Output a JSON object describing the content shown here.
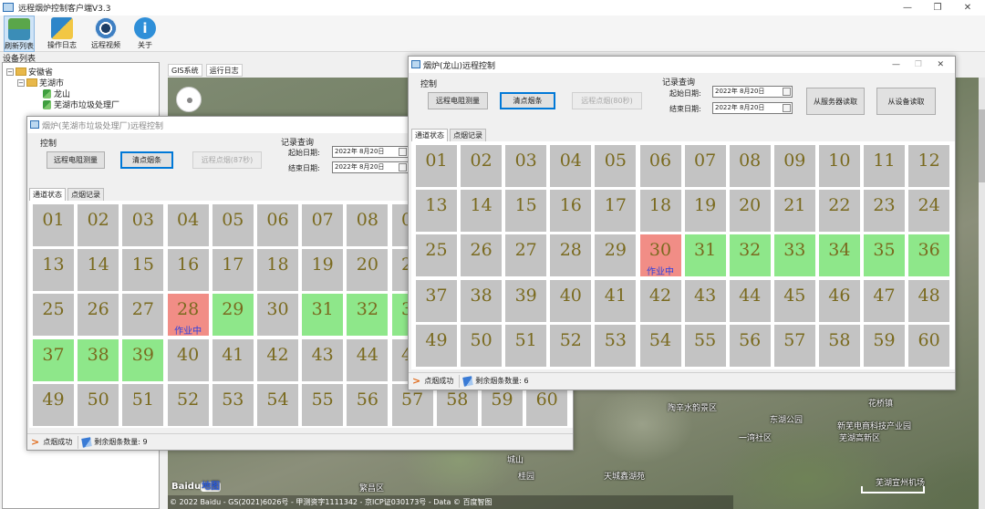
{
  "app": {
    "title": "远程烟炉控制客户端V3.3"
  },
  "window_controls": {
    "minimize": "—",
    "restore": "❐",
    "close": "✕"
  },
  "toolbar": [
    {
      "label": "刷新列表",
      "icon": "refresh-icon"
    },
    {
      "label": "操作日志",
      "icon": "log-icon"
    },
    {
      "label": "远程视频",
      "icon": "camera-icon"
    },
    {
      "label": "关于",
      "icon": "info-icon"
    }
  ],
  "colors": {
    "cell_gray": "#c3c3c3",
    "cell_green": "#8ee78a",
    "cell_red": "#f18d86",
    "cell_text": "#7a6a1f",
    "work_text": "#2a3fe0"
  },
  "device_panel": {
    "label": "设备列表",
    "tree": [
      {
        "label": "安徽省",
        "level": 0,
        "type": "folder"
      },
      {
        "label": "芜湖市",
        "level": 1,
        "type": "folder"
      },
      {
        "label": "龙山",
        "level": 2,
        "type": "leaf"
      },
      {
        "label": "芜湖市垃圾处理厂",
        "level": 2,
        "type": "leaf"
      }
    ]
  },
  "right_tabs": [
    "GIS系统",
    "运行日志"
  ],
  "map": {
    "copyright": "© 2022 Baidu - GS(2021)6026号 - 甲测资字1111342 - 京ICP证030173号 - Data © 百度智图",
    "logo": "Baidu",
    "logo_suffix": "地图",
    "labels": [
      "陶辛水韵景区",
      "东湖公园",
      "新芜电商科技产业园",
      "芜湖高新区",
      "天城鑫湖苑",
      "芜湖宣州机场",
      "一湾社区",
      "繁昌区",
      "花桥镇",
      "桂园",
      "城山"
    ]
  },
  "window_common": {
    "control_group": "控制",
    "btn_resistance": "远程电阻测量",
    "btn_clear": "清点烟条",
    "query_group": "记录查询",
    "start_label": "起始日期:",
    "end_label": "结束日期:",
    "tab_status": "通道状态",
    "tab_records": "点烟记录",
    "working_label": "作业中",
    "status_success": "点烟成功"
  },
  "window1": {
    "title": "烟炉(芜湖市垃圾处理厂)远程控制",
    "btn_remote": "远程点烟(87秒)",
    "start_date": "2022年 8月20日",
    "end_date": "2022年 8月20日",
    "remaining": "剩余烟条数量: 9",
    "cells": {
      "green": [
        29,
        31,
        32,
        33,
        37,
        38,
        39
      ],
      "red": [
        28
      ],
      "working": [
        28
      ]
    }
  },
  "window2": {
    "title": "烟炉(龙山)远程控制",
    "btn_remote": "远程点烟(80秒)",
    "btn_server": "从服务器读取",
    "btn_device": "从设备读取",
    "start_date": "2022年 8月20日",
    "end_date": "2022年 8月20日",
    "remaining": "剩余烟条数量: 6",
    "cells": {
      "green": [
        31,
        32,
        33,
        34,
        35,
        36
      ],
      "red": [
        30
      ],
      "working": [
        30
      ]
    }
  }
}
